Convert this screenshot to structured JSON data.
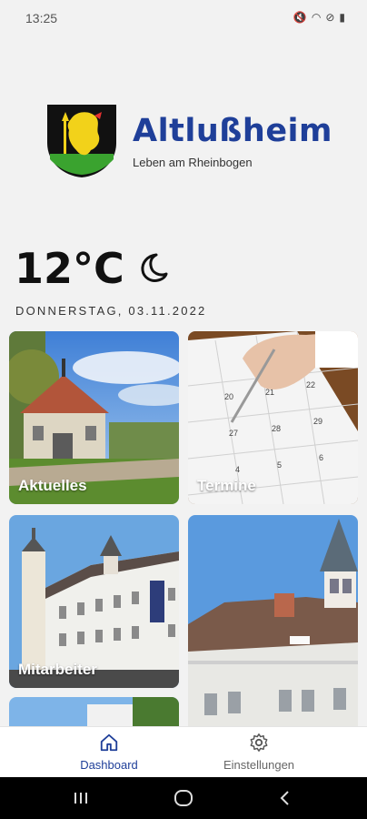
{
  "status": {
    "time": "13:25"
  },
  "brand": {
    "name": "Altlußheim",
    "tagline": "Leben am Rheinbogen"
  },
  "weather": {
    "temperature": "12°C",
    "icon": "moon-icon"
  },
  "date": "DONNERSTAG, 03.11.2022",
  "tiles": [
    {
      "label": "Aktuelles"
    },
    {
      "label": "Termine"
    },
    {
      "label": "Mitarbeiter"
    },
    {
      "label": ""
    }
  ],
  "nav": {
    "dashboard": "Dashboard",
    "settings": "Einstellungen"
  },
  "colors": {
    "accent": "#1f3f99",
    "nav_active": "#1f3f99",
    "nav_inactive": "#666666"
  }
}
